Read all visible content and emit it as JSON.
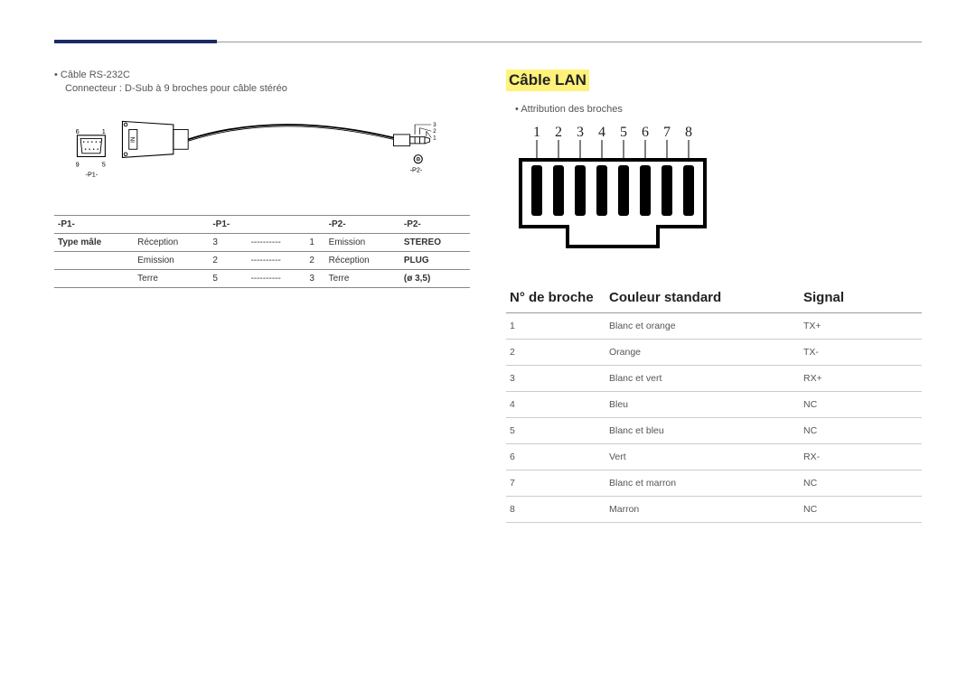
{
  "left": {
    "bullet1": "Câble RS-232C",
    "bullet1_sub": "Connecteur : D-Sub à 9 broches pour câble stéréo",
    "diagram": {
      "p1": "-P1-",
      "p2": "-P2-",
      "n6": "6",
      "n1": "1",
      "n9": "9",
      "n5": "5",
      "n_3": "3",
      "n_2": "2",
      "n_1": "1"
    },
    "table": {
      "headers": [
        "-P1-",
        "-P1-",
        "",
        "",
        "-P2-",
        "-P2-",
        ""
      ],
      "row_label": "Type mâle",
      "rows": [
        [
          "Réception",
          "3",
          "----------",
          "1",
          "Emission",
          "STEREO"
        ],
        [
          "Emission",
          "2",
          "----------",
          "2",
          "Réception",
          "PLUG"
        ],
        [
          "Terre",
          "5",
          "----------",
          "3",
          "Terre",
          "(ø 3,5)"
        ]
      ]
    }
  },
  "right": {
    "title": "Câble LAN",
    "bullet1": "Attribution des broches",
    "pins": [
      "1",
      "2",
      "3",
      "4",
      "5",
      "6",
      "7",
      "8"
    ],
    "table": {
      "headers": [
        "N° de broche",
        "Couleur standard",
        "Signal"
      ],
      "rows": [
        [
          "1",
          "Blanc et orange",
          "TX+"
        ],
        [
          "2",
          "Orange",
          "TX-"
        ],
        [
          "3",
          "Blanc et vert",
          "RX+"
        ],
        [
          "4",
          "Bleu",
          "NC"
        ],
        [
          "5",
          "Blanc et bleu",
          "NC"
        ],
        [
          "6",
          "Vert",
          "RX-"
        ],
        [
          "7",
          "Blanc et marron",
          "NC"
        ],
        [
          "8",
          "Marron",
          "NC"
        ]
      ]
    }
  }
}
